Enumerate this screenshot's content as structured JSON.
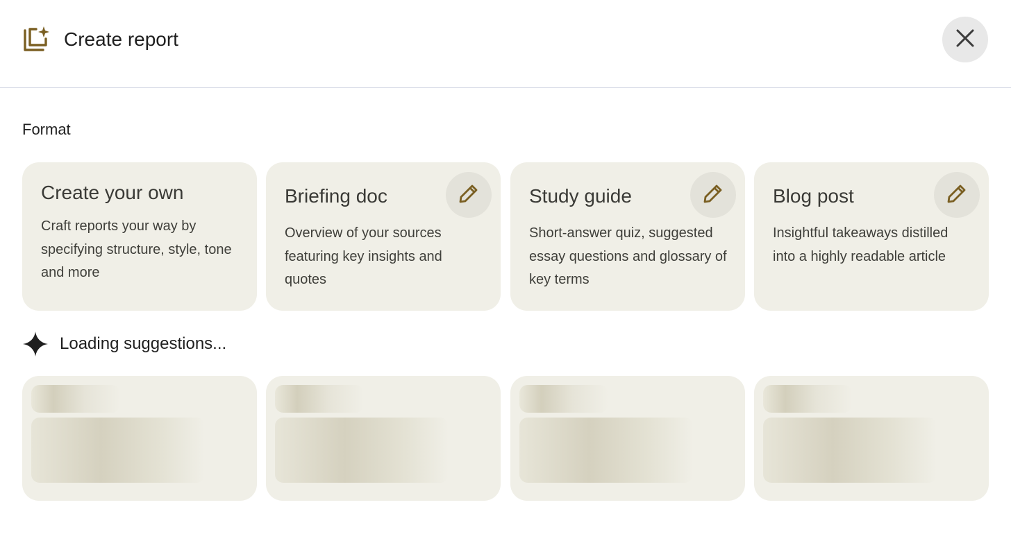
{
  "header": {
    "title": "Create report",
    "icon": "report-sparkle-icon",
    "close_icon": "close-icon"
  },
  "format": {
    "label": "Format",
    "cards": [
      {
        "title": "Create your own",
        "description": "Craft reports your way by specifying structure, style, tone and more",
        "editable": false
      },
      {
        "title": "Briefing doc",
        "description": "Overview of your sources featuring key insights and quotes",
        "editable": true
      },
      {
        "title": "Study guide",
        "description": "Short-answer quiz, suggested essay questions and glossary of key terms",
        "editable": true
      },
      {
        "title": "Blog post",
        "description": "Insightful takeaways distilled into a highly readable article",
        "editable": true
      }
    ]
  },
  "suggestions": {
    "loading_text": "Loading suggestions...",
    "icon": "sparkle-icon",
    "placeholder_count": 4
  },
  "colors": {
    "accent": "#7a5f22",
    "card_bg": "#f0efe7",
    "close_bg": "#e8e8e8",
    "edit_bg": "#e3e2da"
  }
}
